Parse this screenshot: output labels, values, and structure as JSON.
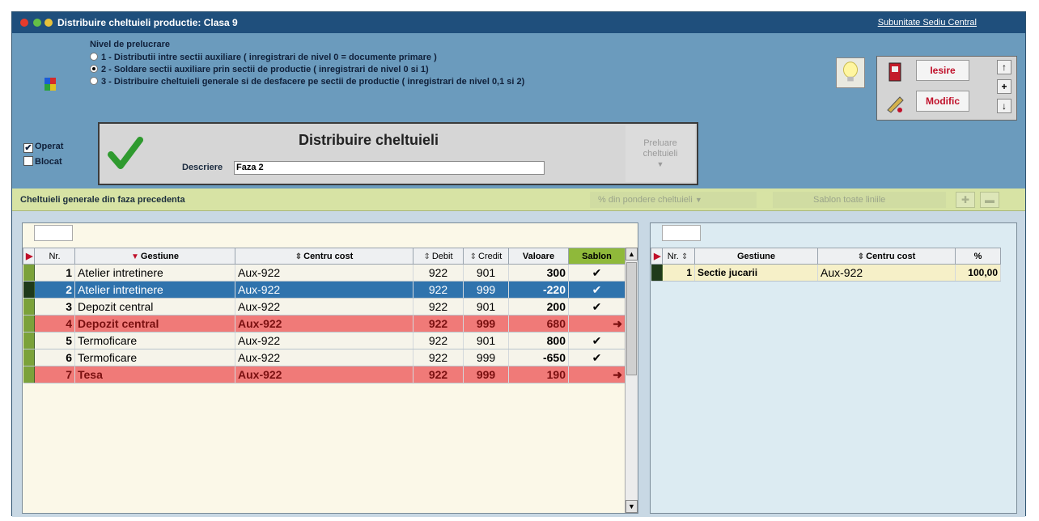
{
  "window": {
    "title": "Distribuire cheltuieli productie: Clasa 9",
    "subunit": "Subunitate Sediu Central"
  },
  "nivel": {
    "heading": "Nivel de prelucrare",
    "options": [
      "1 - Distributii intre sectii auxiliare ( inregistrari de nivel 0 = documente primare )",
      "2 - Soldare sectii auxiliare prin sectii de productie  ( inregistrari de nivel 0 si 1)",
      "3 - Distribuire cheltuieli generale si de desfacere pe sectii de productie ( inregistrari de nivel 0,1 si 2)"
    ],
    "selected_index": 1
  },
  "flags": {
    "operat_label": "Operat",
    "blocat_label": "Blocat",
    "operat_checked": true,
    "blocat_checked": false
  },
  "panel": {
    "title": "Distribuire cheltuieli",
    "descriere_label": "Descriere",
    "descriere_value": "Faza 2",
    "preluare_line1": "Preluare",
    "preluare_line2": "cheltuieli"
  },
  "buttons": {
    "iesire": "Iesire",
    "modific": "Modific",
    "up": "↑",
    "plus": "+",
    "down": "↓"
  },
  "bar": {
    "label": "Cheltuieli generale din faza precedenta",
    "pondere": "% din pondere cheltuieli",
    "sablon_toate": "Sablon toate liniile"
  },
  "left_table": {
    "headers": [
      "Nr.",
      "Gestiune",
      "Centru cost",
      "Debit",
      "Credit",
      "Valoare",
      "Sablon"
    ],
    "rows": [
      {
        "nr": "1",
        "gestiune": "Atelier intretinere",
        "centru": "Aux-922",
        "debit": "922",
        "credit": "901",
        "valoare": "300",
        "sablon": "✔",
        "style": "norm"
      },
      {
        "nr": "2",
        "gestiune": "Atelier intretinere",
        "centru": "Aux-922",
        "debit": "922",
        "credit": "999",
        "valoare": "-220",
        "sablon": "✔",
        "style": "sel"
      },
      {
        "nr": "3",
        "gestiune": "Depozit central",
        "centru": "Aux-922",
        "debit": "922",
        "credit": "901",
        "valoare": "200",
        "sablon": "✔",
        "style": "norm"
      },
      {
        "nr": "4",
        "gestiune": "Depozit central",
        "centru": "Aux-922",
        "debit": "922",
        "credit": "999",
        "valoare": "680",
        "sablon": "➜",
        "style": "red"
      },
      {
        "nr": "5",
        "gestiune": "Termoficare",
        "centru": "Aux-922",
        "debit": "922",
        "credit": "901",
        "valoare": "800",
        "sablon": "✔",
        "style": "norm"
      },
      {
        "nr": "6",
        "gestiune": "Termoficare",
        "centru": "Aux-922",
        "debit": "922",
        "credit": "999",
        "valoare": "-650",
        "sablon": "✔",
        "style": "norm"
      },
      {
        "nr": "7",
        "gestiune": "Tesa",
        "centru": "Aux-922",
        "debit": "922",
        "credit": "999",
        "valoare": "190",
        "sablon": "➜",
        "style": "red"
      }
    ]
  },
  "right_table": {
    "headers": [
      "Nr.",
      "Gestiune",
      "Centru cost",
      "%"
    ],
    "rows": [
      {
        "nr": "1",
        "gestiune": "Sectie jucarii",
        "centru": "Aux-922",
        "pct": "100,00"
      }
    ]
  },
  "colors": {
    "titlebar": "#1f4f7c",
    "selected_row": "#2f73ad",
    "red_row": "#f07a78",
    "accent_green": "#7ba23a"
  }
}
